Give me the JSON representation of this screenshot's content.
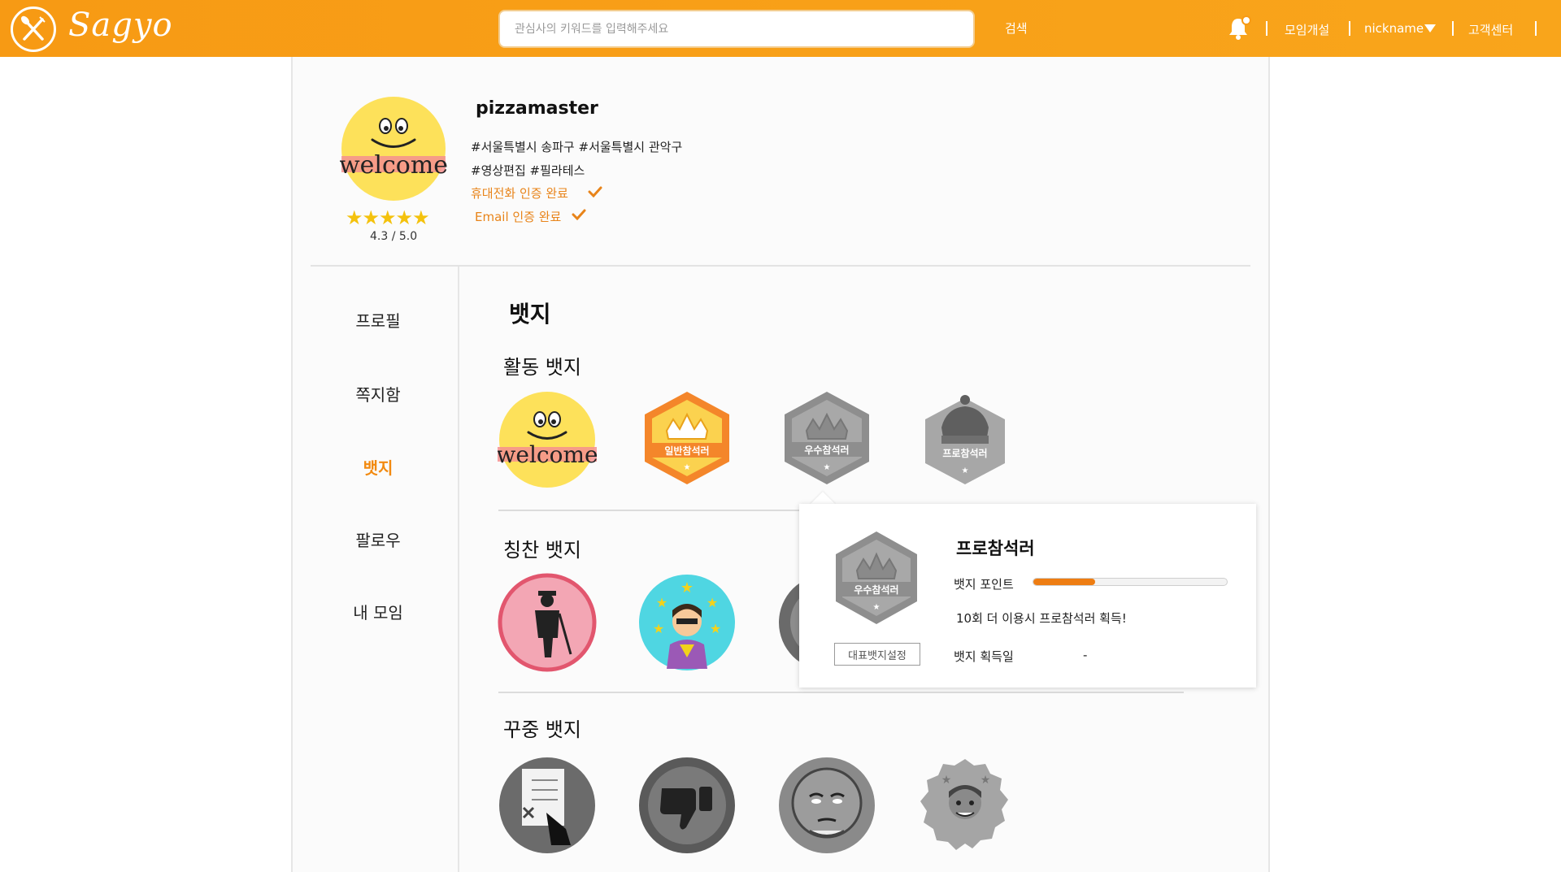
{
  "header": {
    "logo_text": "Sagyo",
    "search_placeholder": "관심사의 키워드를 입력해주세요",
    "search_button": "검색",
    "links": {
      "create_meeting": "모임개설",
      "nickname": "nickname",
      "support": "고객센터"
    },
    "accent_color": "#f79a14"
  },
  "profile": {
    "username": "pizzamaster",
    "tags_line1": "#서울특별시 송파구  #서울특별시 관악구",
    "tags_line2": "#영상편집 #필라테스",
    "phone_verified": "휴대전화 인증 완료",
    "email_verified": "Email 인증 완료",
    "stars": "★★★★★",
    "rating": "4.3 / 5.0",
    "rating_value": 4.3,
    "avatar_text": "welcome"
  },
  "sidebar": {
    "items": [
      {
        "label": "프로필",
        "active": false
      },
      {
        "label": "쪽지함",
        "active": false
      },
      {
        "label": "뱃지",
        "active": true
      },
      {
        "label": "팔로우",
        "active": false
      },
      {
        "label": "내 모임",
        "active": false
      }
    ]
  },
  "badges": {
    "title": "뱃지",
    "activity": {
      "title": "활동 뱃지",
      "items": [
        {
          "name": "welcome-badge",
          "label": "welcome"
        },
        {
          "name": "normal-participant-badge",
          "label": "일반참석러"
        },
        {
          "name": "excellent-participant-badge",
          "label": "우수참석러"
        },
        {
          "name": "pro-participant-badge",
          "label": "프로참석러"
        }
      ]
    },
    "praise": {
      "title": "칭찬 뱃지",
      "items": [
        {
          "name": "gentleman-badge"
        },
        {
          "name": "star-badge"
        },
        {
          "name": "praise-badge-3"
        }
      ]
    },
    "scold": {
      "title": "꾸중 뱃지",
      "items": [
        {
          "name": "checklist-badge"
        },
        {
          "name": "thumbs-down-badge"
        },
        {
          "name": "sleepy-face-badge"
        },
        {
          "name": "dizzy-face-badge"
        }
      ]
    }
  },
  "popup": {
    "title": "프로참석러",
    "badge_label": "우수참석러",
    "point_label": "뱃지 포인트",
    "point_progress": 0.32,
    "message": "10회 더 이용시 프로참석러 획득!",
    "acquired_label": "뱃지 획득일",
    "acquired_value": "-",
    "set_rep_button": "대표뱃지설정"
  }
}
